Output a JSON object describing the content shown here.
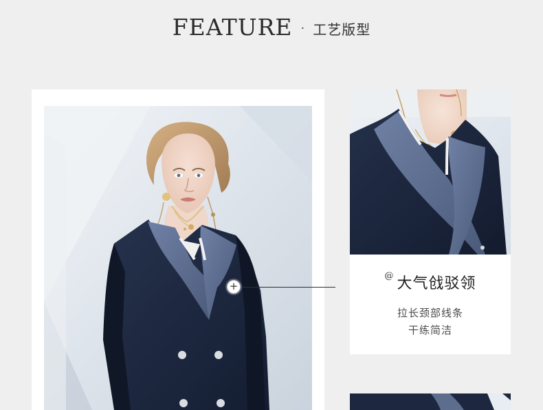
{
  "header": {
    "title_en": "FEATURE",
    "separator": "·",
    "title_cn": "工艺版型"
  },
  "detail": {
    "at_symbol": "@",
    "title": "大气戗驳领",
    "line1": "拉长颈部线条",
    "line2": "干练简洁"
  },
  "colors": {
    "page_bg": "#efefef",
    "card_bg": "#ffffff",
    "jacket_navy": "#1b2740",
    "lapel_blue": "#59698a"
  },
  "icons": {
    "hotspot": "plus-icon"
  }
}
